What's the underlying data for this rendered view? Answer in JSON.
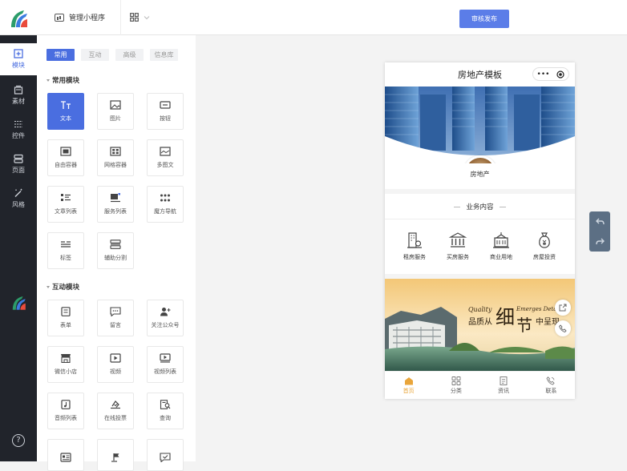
{
  "topbar": {
    "manage_label": "管理小程序",
    "publish_label": "审核发布"
  },
  "sidebar": {
    "items": [
      {
        "label": "模块",
        "icon": "plus-square-icon"
      },
      {
        "label": "素材",
        "icon": "material-icon"
      },
      {
        "label": "控件",
        "icon": "controls-icon"
      },
      {
        "label": "页面",
        "icon": "pages-icon"
      },
      {
        "label": "风格",
        "icon": "magic-wand-icon"
      }
    ]
  },
  "panel": {
    "tabs": [
      "常用",
      "互动",
      "高级",
      "信息库"
    ],
    "section_common": "常用模块",
    "common_items": [
      "文本",
      "图片",
      "按钮",
      "自由容器",
      "网格容器",
      "多图文",
      "文章列表",
      "服务列表",
      "魔方导航",
      "标签",
      "辅助分割"
    ],
    "section_interactive": "互动模块",
    "interactive_items": [
      "表单",
      "留言",
      "关注公众号",
      "微信小店",
      "视频",
      "视频列表",
      "音频列表",
      "在线投票",
      "查询"
    ]
  },
  "phone": {
    "title": "房地产模板",
    "profile_name": "房地产",
    "business_title": "业务内容",
    "services": [
      "租房服务",
      "买房服务",
      "商业用地",
      "房屋投资"
    ],
    "promo": {
      "quality": "Quality",
      "emerges": "Emerges Deta",
      "cn_1": "品质从",
      "cn_big1": "细",
      "cn_big2": "节",
      "cn_2": "中呈现"
    },
    "tabs": [
      "首页",
      "分类",
      "资讯",
      "联系"
    ]
  },
  "colors": {
    "accent": "#4a6ee0",
    "sidebar_bg": "#21242b",
    "publish": "#5b7de8",
    "tab_active": "#e9a53a"
  }
}
